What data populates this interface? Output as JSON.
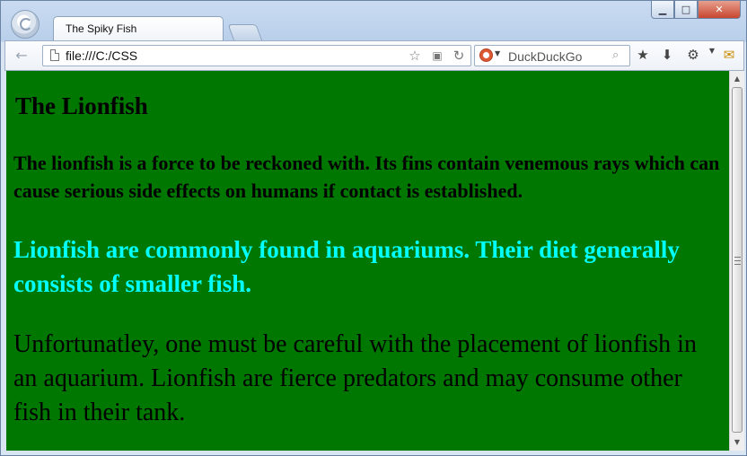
{
  "browser": {
    "tab_title": "The Spiky Fish",
    "address": "file:///C:/CSS",
    "search_engine": "DuckDuckGo",
    "window_controls": {
      "minimize": "▁",
      "maximize": "□",
      "close": "✕"
    }
  },
  "page": {
    "heading": "The Lionfish",
    "intro": "The lionfish is a force to be reckoned with. Its fins contain venemous rays which can cause serious side effects on humans if contact is established.",
    "diet": "Lionfish are commonly found in aquariums. Their diet generally consists of smaller fish.",
    "warning": "Unfortunatley, one must be careful with the placement of lionfish in an aquarium. Lionfish are fierce predators and may consume other fish in their tank."
  },
  "colors": {
    "page_background": "#007700",
    "diet_text": "#00ffff",
    "body_text": "#000000"
  },
  "icons": {
    "back": "back-arrow-icon",
    "page": "page-icon",
    "bookmark": "star-icon",
    "menu": "page-menu-icon",
    "reload": "reload-icon",
    "search": "search-icon",
    "bookmarks": "bookmarks-star-icon",
    "download": "download-icon",
    "tools": "wrench-icon",
    "email": "mail-icon"
  }
}
